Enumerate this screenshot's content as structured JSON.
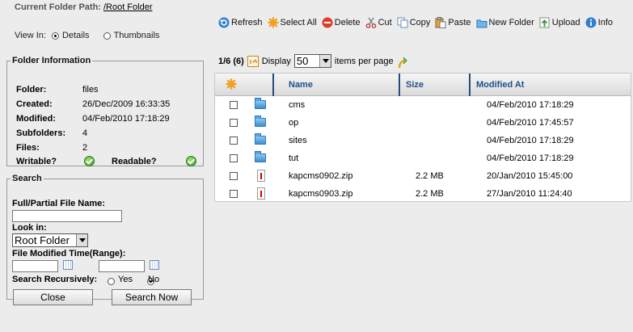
{
  "header": {
    "path_label": "Current Folder Path:",
    "path_value": "/Root Folder"
  },
  "view": {
    "label": "View In:",
    "details": "Details",
    "thumbnails": "Thumbnails",
    "selected": "Details"
  },
  "toolbar": {
    "refresh": "Refresh",
    "select_all": "Select All",
    "delete": "Delete",
    "cut": "Cut",
    "copy": "Copy",
    "paste": "Paste",
    "new_folder": "New Folder",
    "upload": "Upload",
    "info": "Info"
  },
  "folder_info": {
    "title": "Folder Information",
    "folder_label": "Folder:",
    "folder_value": "files",
    "created_label": "Created:",
    "created_value": "26/Dec/2009 16:33:35",
    "modified_label": "Modified:",
    "modified_value": "04/Feb/2010 17:18:29",
    "subfolders_label": "Subfolders:",
    "subfolders_value": "4",
    "files_label": "Files:",
    "files_value": "2",
    "writable_label": "Writable?",
    "readable_label": "Readable?"
  },
  "search": {
    "title": "Search",
    "name_label": "Full/Partial File Name:",
    "name_value": "",
    "look_in_label": "Look in:",
    "look_in_value": "Root Folder",
    "modified_range_label": "File Modified Time(Range):",
    "recursive_label": "Search Recursively:",
    "yes": "Yes",
    "no": "No",
    "recursive_selected": "No",
    "close_button": "Close",
    "search_button": "Search Now"
  },
  "paging": {
    "summary": "1/6 (6)",
    "display_label": "Display",
    "per_page_value": "50",
    "per_page_suffix": "items per page"
  },
  "grid": {
    "columns": [
      "Name",
      "Size",
      "Modified At"
    ],
    "rows": [
      {
        "type": "folder",
        "name": "cms",
        "size": "",
        "modified": "04/Feb/2010 17:18:29"
      },
      {
        "type": "folder",
        "name": "op",
        "size": "",
        "modified": "04/Feb/2010 17:45:57"
      },
      {
        "type": "folder",
        "name": "sites",
        "size": "",
        "modified": "04/Feb/2010 17:18:29"
      },
      {
        "type": "folder",
        "name": "tut",
        "size": "",
        "modified": "04/Feb/2010 17:18:29"
      },
      {
        "type": "zip",
        "name": "kapcms0902.zip",
        "size": "2.2 MB",
        "modified": "20/Jan/2010 15:45:00"
      },
      {
        "type": "zip",
        "name": "kapcms0903.zip",
        "size": "2.2 MB",
        "modified": "27/Jan/2010 11:24:40"
      }
    ]
  },
  "colors": {
    "accent": "#1f4f8a",
    "background": "#ececec",
    "ok_green": "#3c9a1f"
  }
}
